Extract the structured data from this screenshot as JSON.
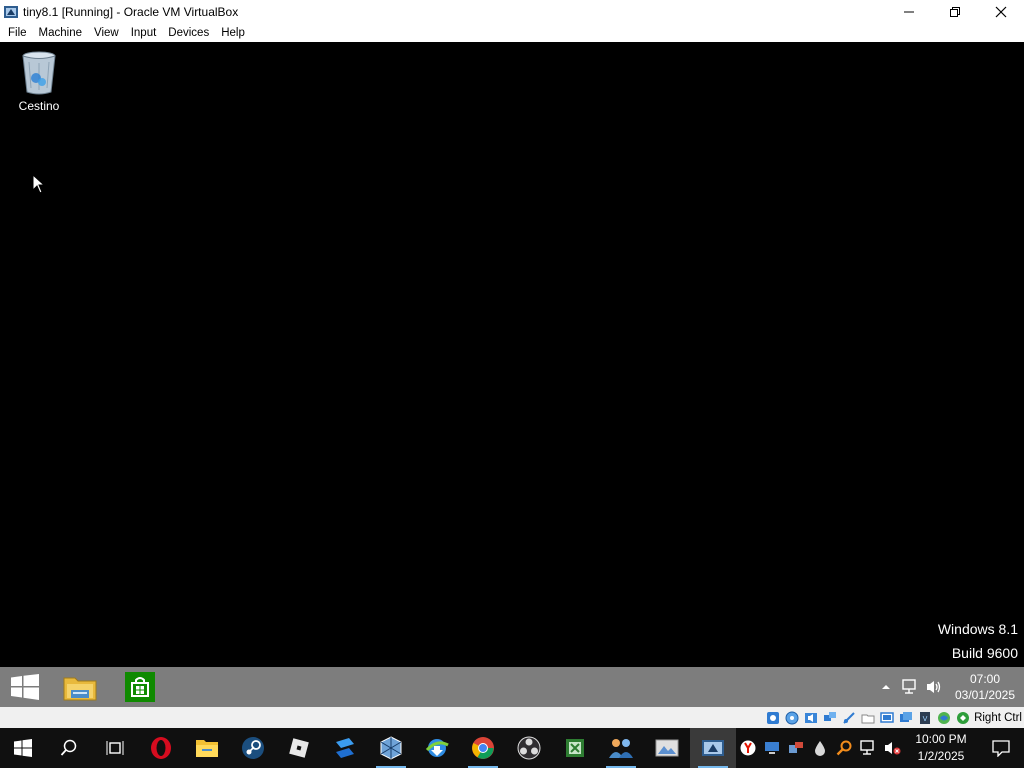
{
  "window": {
    "title": "tiny8.1 [Running] - Oracle VM VirtualBox"
  },
  "menubar": {
    "items": [
      "File",
      "Machine",
      "View",
      "Input",
      "Devices",
      "Help"
    ]
  },
  "guest": {
    "desktop_icons": [
      {
        "label": "Cestino",
        "icon": "recycle-bin-icon"
      }
    ],
    "watermark": {
      "line1": "Windows 8.1",
      "line2": "Build 9600"
    },
    "taskbar": {
      "apps": [
        "start-button",
        "file-explorer-icon",
        "windows-store-icon"
      ],
      "clock": {
        "time": "07:00",
        "date": "03/01/2025"
      }
    }
  },
  "vbox_status": {
    "host_key": "Right Ctrl",
    "icons": [
      "hard-disk-icon",
      "optical-drive-icon",
      "audio-icon",
      "network-icon",
      "usb-icon",
      "shared-folders-icon",
      "display-icon",
      "recording-icon",
      "cpu-icon",
      "mouse-integration-icon",
      "keyboard-icon"
    ]
  },
  "host_taskbar": {
    "apps": [
      "start-button",
      "search-icon",
      "task-view-icon",
      "opera-icon",
      "file-explorer-icon",
      "steam-icon",
      "roblox-icon",
      "roblox-studio-icon",
      "virtualbox-icon",
      "internet-download-manager-icon",
      "chrome-icon",
      "obs-icon",
      "excel-like-icon",
      "people-icon",
      "photo-viewer-icon",
      "virtualbox-window-icon"
    ],
    "tray": [
      "yandex-icon",
      "monitor-icon",
      "device-manager-icon",
      "drop-icon",
      "search-tool-icon",
      "network-icon",
      "volume-muted-icon"
    ],
    "clock": {
      "time": "10:00 PM",
      "date": "1/2/2025"
    }
  },
  "colors": {
    "guest_taskbar": "#7d7d7d",
    "host_taskbar": "#101010",
    "store_green": "#0f8a00",
    "accent_blue": "#76b9ed"
  }
}
